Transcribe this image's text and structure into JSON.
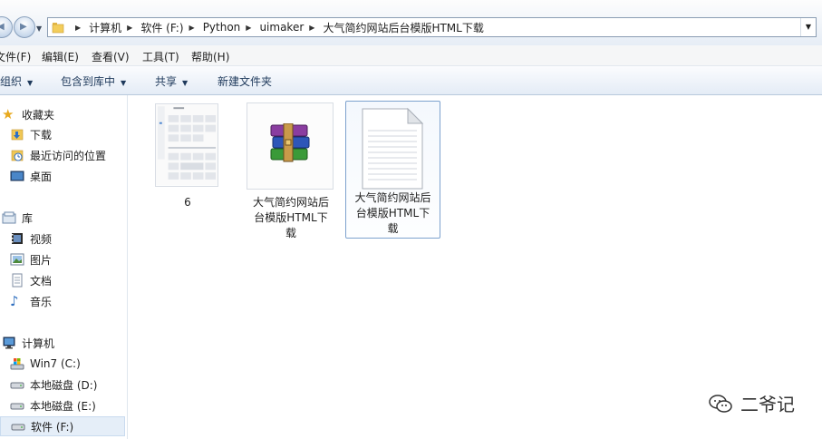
{
  "address": {
    "crumbs": [
      "计算机",
      "软件 (F:)",
      "Python",
      "uimaker",
      "大气简约网站后台模版HTML下载"
    ]
  },
  "menu": [
    "文件(F)",
    "编辑(E)",
    "查看(V)",
    "工具(T)",
    "帮助(H)"
  ],
  "toolbar": {
    "organize": "组织",
    "include": "包含到库中",
    "share": "共享",
    "new_folder": "新建文件夹"
  },
  "nav": {
    "favorites": "收藏夹",
    "downloads": "下载",
    "recent": "最近访问的位置",
    "desktop": "桌面",
    "libraries": "库",
    "videos": "视频",
    "pictures": "图片",
    "documents": "文档",
    "music": "音乐",
    "computer": "计算机",
    "drive_c": "Win7 (C:)",
    "drive_d": "本地磁盘 (D:)",
    "drive_e": "本地磁盘 (E:)",
    "drive_f": "软件 (F:)"
  },
  "files": [
    {
      "name": "6",
      "icon": "image-thumbnail"
    },
    {
      "name_lines": [
        "大气简约网站后",
        "台模版HTML下",
        "载"
      ],
      "icon": "winrar-archive-icon"
    },
    {
      "name_lines": [
        "大气简约网站后",
        "台模版HTML下",
        "载"
      ],
      "icon": "text-document-icon"
    }
  ],
  "watermark": "二爷记"
}
